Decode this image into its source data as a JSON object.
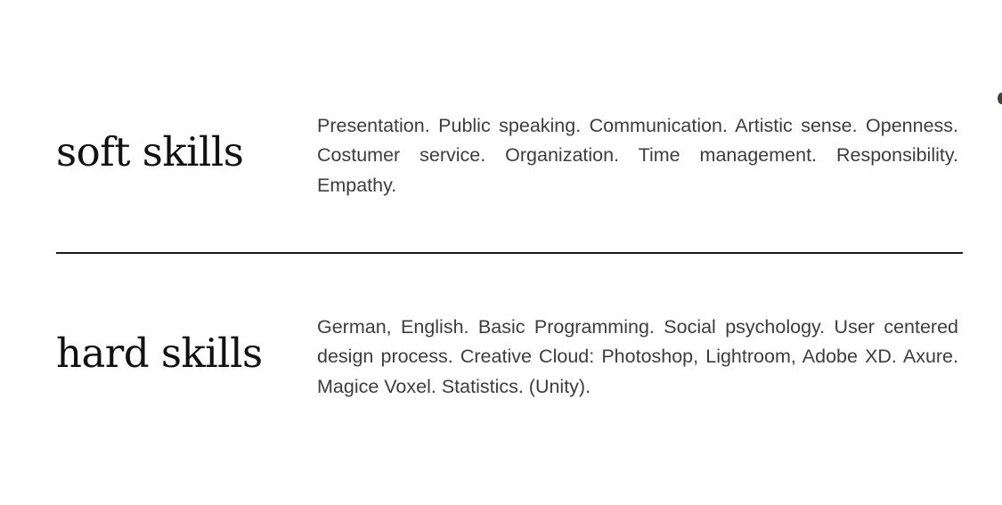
{
  "sections": [
    {
      "title": "soft skills",
      "text": "Presentation. Public speaking. Communication. Artistic sense. Openness. Costumer service. Organization. Time management. Responsibility. Empathy."
    },
    {
      "title": "hard skills",
      "text": "German, English. Basic Programming. Social psychology. User centered design process. Creative Cloud: Photoshop, Lightroom, Adobe XD. Axure. Magice Voxel.  Statistics. (Unity)."
    }
  ]
}
